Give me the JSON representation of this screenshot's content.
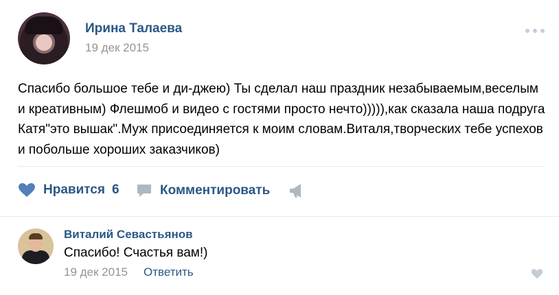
{
  "post": {
    "author": "Ирина Талаева",
    "date": "19 дек 2015",
    "text": "Спасибо большое тебе и ди-джею) Ты сделал наш праздник незабываемым,веселым и креативным) Флешмоб и видео с гостями просто нечто))))),как сказала наша подруга Катя\"это вышак\".Муж присоединяется к моим словам.Виталя,творческих тебе успехов и побольше хороших заказчиков)"
  },
  "actions": {
    "like_label": "Нравится",
    "like_count": "6",
    "comment_label": "Комментировать"
  },
  "reply": {
    "author": "Виталий Севастьянов",
    "text": "Спасибо! Счастья вам!)",
    "date": "19 дек 2015",
    "reply_link": "Ответить"
  },
  "colors": {
    "link": "#2a5885",
    "meta": "#939393",
    "icon": "#5181b8",
    "icon_muted": "#aeb7c2"
  },
  "icons": [
    "more-icon",
    "heart-icon",
    "comment-icon",
    "share-icon",
    "small-heart-icon"
  ]
}
